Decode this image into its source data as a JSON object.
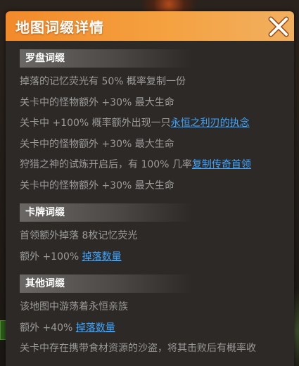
{
  "dialog": {
    "title": "地图词缀详情",
    "close_icon": "close-icon"
  },
  "sections": {
    "compass": {
      "label": "罗盘词缀",
      "lines": [
        {
          "text": "掉落的记忆荧光有 50% 概率复制一份",
          "link": ""
        },
        {
          "text": "关卡中的怪物额外 +30% 最大生命",
          "link": ""
        },
        {
          "text": "关卡中 +100% 概率额外出现一只",
          "link": "永恒之利刃的执念"
        },
        {
          "text": "关卡中的怪物额外 +30% 最大生命",
          "link": ""
        },
        {
          "text": "狩猎之神的试炼开启后，有 100% 几率",
          "link": "复制传奇首领"
        },
        {
          "text": "关卡中的怪物额外 +30% 最大生命",
          "link": ""
        }
      ]
    },
    "card": {
      "label": "卡牌词缀",
      "lines": [
        {
          "text": "首领额外掉落 8枚记忆荧光",
          "link": ""
        },
        {
          "text": "额外 +100% ",
          "link": "掉落数量"
        }
      ]
    },
    "other": {
      "label": "其他词缀",
      "lines": [
        {
          "text": "该地图中游荡着永恒亲族",
          "link": ""
        },
        {
          "text": "额外 +40% ",
          "link": "掉落数量"
        },
        {
          "text": "关卡中存在携带食材资源的沙盗，将其击败后有概率收",
          "link": ""
        }
      ]
    }
  },
  "colors": {
    "header_accent": "#f28a2a",
    "link": "#3fa6ff",
    "body_text": "#9d9c9a"
  }
}
